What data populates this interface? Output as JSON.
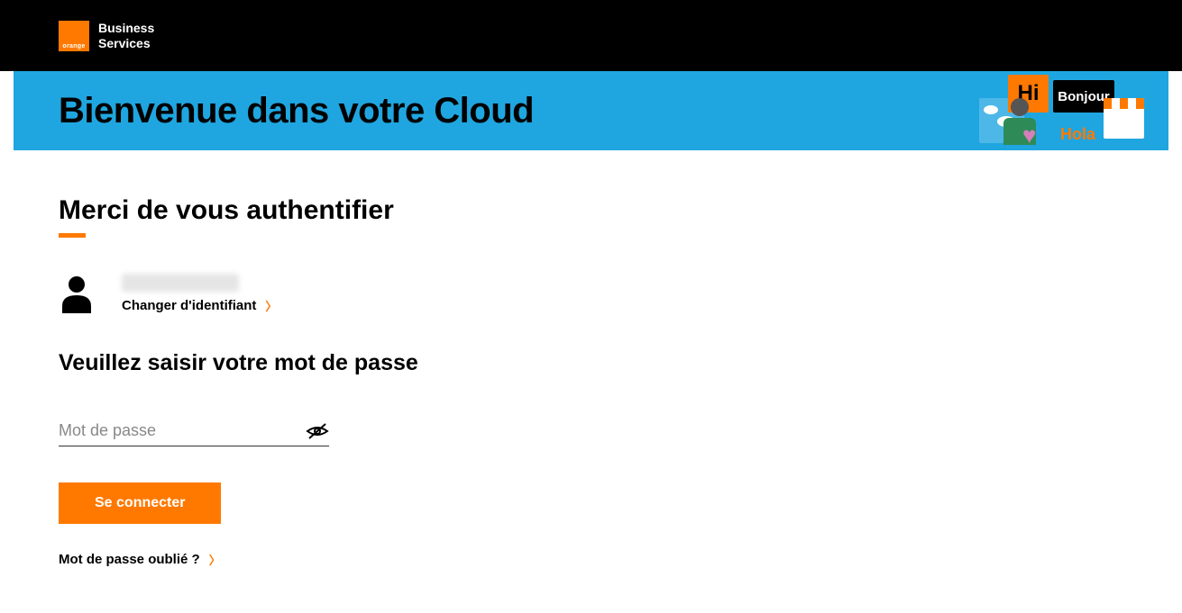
{
  "header": {
    "logo_text": "orange",
    "brand_line1": "Business",
    "brand_line2": "Services"
  },
  "banner": {
    "title": "Bienvenue dans votre Cloud",
    "hi_text": "Hi",
    "bonjour_text": "Bonjour",
    "hola_text": "Hola"
  },
  "auth": {
    "heading": "Merci de vous authentifier",
    "change_id_label": "Changer d'identifiant",
    "password_heading": "Veuillez saisir votre mot de passe",
    "password_placeholder": "Mot de passe",
    "login_button_label": "Se connecter",
    "forgot_password_label": "Mot de passe oublié ?"
  },
  "colors": {
    "orange": "#ff7900",
    "blue": "#1fa6e0",
    "black": "#000000"
  }
}
